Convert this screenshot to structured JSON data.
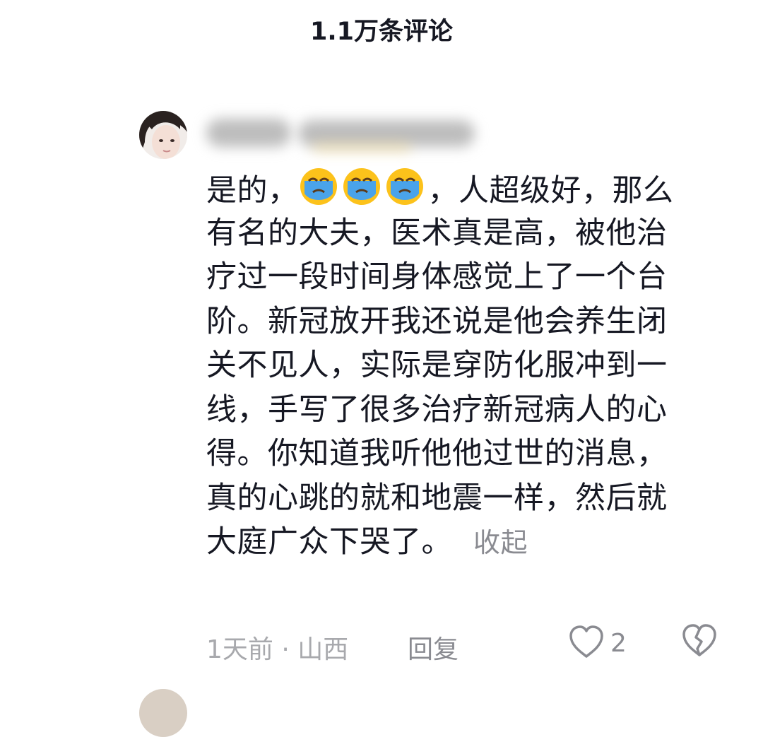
{
  "header": {
    "title": "1.1万条评论"
  },
  "comment": {
    "lines": [
      {
        "pre": "是的，",
        "emoji_count": 3,
        "post": "，人超级好，那么"
      },
      {
        "text": "有名的大夫，医术真是高，被他治"
      },
      {
        "text": "疗过一段时间身体感觉上了一个台"
      },
      {
        "text": "阶。新冠放开我还说是他会养生闭"
      },
      {
        "text": "关不见人，实际是穿防化服冲到一"
      },
      {
        "text": "线，手写了很多治疗新冠病人的心"
      },
      {
        "text": "得。你知道我听他他过世的消息，"
      },
      {
        "text": "真的心跳的就和地震一样，然后就"
      },
      {
        "text": "大庭广众下哭了。"
      }
    ],
    "emoji_name": "crying-face-emoji",
    "collapse_label": "收起",
    "time_location": "1天前 · 山西",
    "reply_label": "回复",
    "like_count": "2"
  },
  "icons": {
    "like": "heart-outline-icon",
    "dislike": "broken-heart-icon"
  },
  "colors": {
    "text_primary": "#161823",
    "text_secondary": "#8a8b91",
    "text_tertiary": "#a8a9ad",
    "emoji_face": "#fcc21b",
    "emoji_tears": "#4aa3ea"
  }
}
